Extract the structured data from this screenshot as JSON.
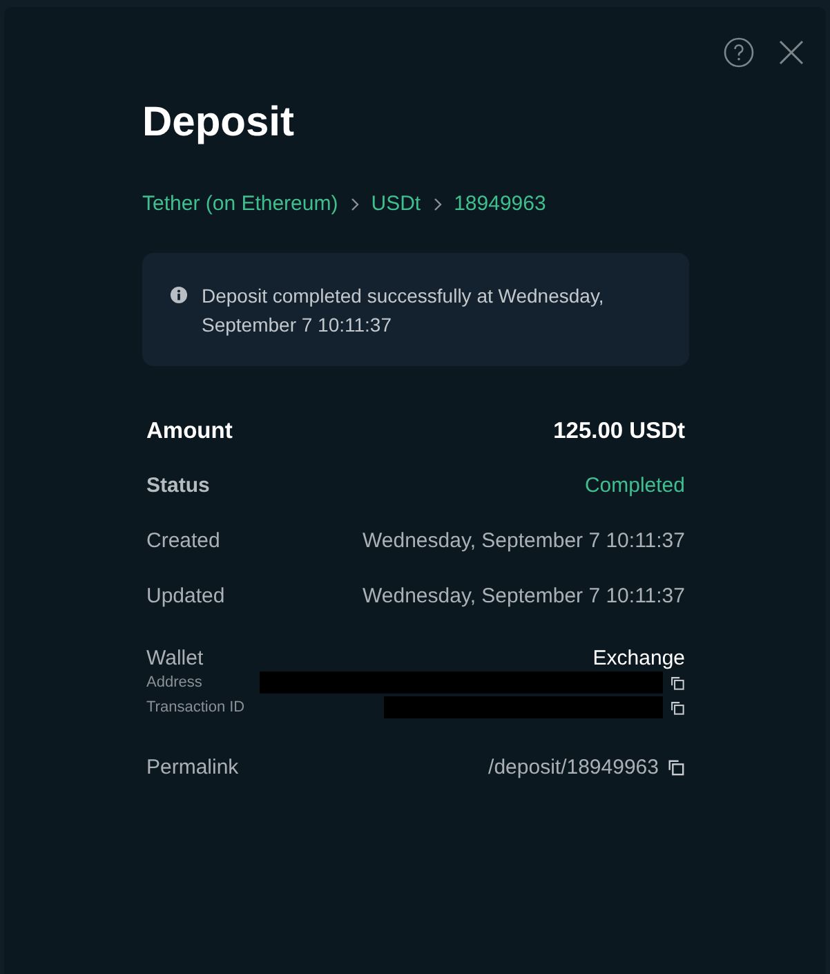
{
  "dialog": {
    "title": "Deposit",
    "breadcrumb": [
      "Tether (on Ethereum)",
      "USDt",
      "18949963"
    ],
    "notice": "Deposit completed successfully at Wednesday, September 7 10:11:37",
    "rows": [
      {
        "kind": "amount",
        "label": "Amount",
        "value": "125.00 USDt"
      },
      {
        "kind": "status",
        "label": "Status",
        "value": "Completed"
      },
      {
        "kind": "plain",
        "label": "Created",
        "value": "Wednesday, September 7 10:11:37"
      },
      {
        "kind": "plain",
        "label": "Updated",
        "value": "Wednesday, September 7 10:11:37"
      },
      {
        "kind": "wallet",
        "label": "Wallet",
        "value": "Exchange",
        "details": [
          {
            "label": "Address"
          },
          {
            "label": "Transaction ID"
          }
        ]
      },
      {
        "kind": "link",
        "label": "Permalink",
        "value": "/deposit/18949963"
      }
    ]
  }
}
